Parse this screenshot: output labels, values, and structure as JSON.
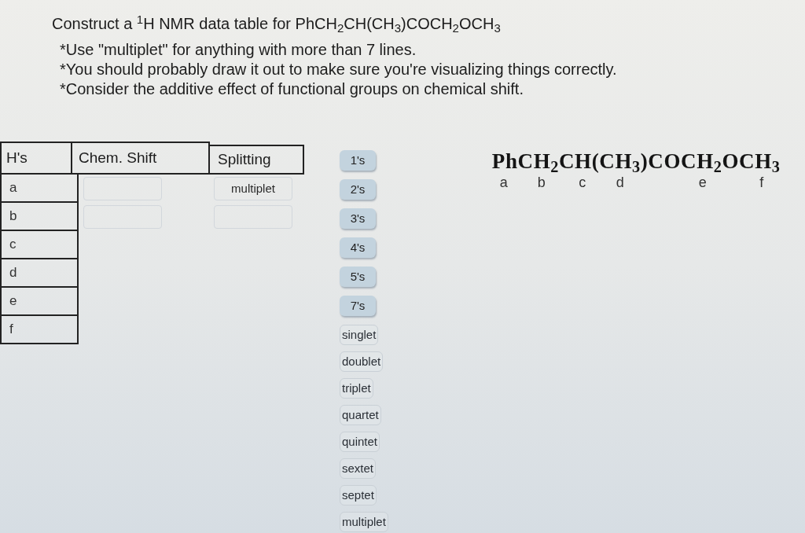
{
  "question": {
    "title": "Construct a $^{1}$H NMR data table for PhCH$_{2}$CH(CH$_{3}$)COCH$_{2}$OCH$_{3}$",
    "notes": [
      "*Use \"multiplet\" for anything with more than 7 lines.",
      "*You should probably draw it out to make sure you're visualizing things correctly.",
      "*Consider the additive effect of functional groups on chemical shift."
    ]
  },
  "table": {
    "columns": [
      "H's",
      "Chem. Shift",
      "Splitting"
    ],
    "rows": [
      {
        "label": "a",
        "drop_zones_visible": true,
        "splitting": "multiplet"
      },
      {
        "label": "b",
        "drop_zones_visible": true
      },
      {
        "label": "c",
        "drop_zones_visible": false
      },
      {
        "label": "d",
        "drop_zones_visible": false
      },
      {
        "label": "e",
        "drop_zones_visible": false
      },
      {
        "label": "f",
        "drop_zones_visible": false
      }
    ]
  },
  "answer_tiles": [
    {
      "kind": "count",
      "label": "1's"
    },
    {
      "kind": "count",
      "label": "2's"
    },
    {
      "kind": "count",
      "label": "3's"
    },
    {
      "kind": "count",
      "label": "4's"
    },
    {
      "kind": "count",
      "label": "5's"
    },
    {
      "kind": "count",
      "label": "7's"
    },
    {
      "kind": "splitting",
      "label": "singlet"
    },
    {
      "kind": "splitting",
      "label": "doublet"
    },
    {
      "kind": "splitting",
      "label": "triplet"
    },
    {
      "kind": "splitting",
      "label": "quartet"
    },
    {
      "kind": "splitting",
      "label": "quintet"
    },
    {
      "kind": "splitting",
      "label": "sextet"
    },
    {
      "kind": "splitting",
      "label": "septet"
    },
    {
      "kind": "splitting",
      "label": "multiplet"
    }
  ],
  "formula": {
    "text": "PhCH$_{2}$CH(CH$_{3}$)COCH$_{2}$OCH$_{3}$",
    "labels": [
      "a",
      "b",
      "c",
      "d",
      "e",
      "f"
    ]
  }
}
